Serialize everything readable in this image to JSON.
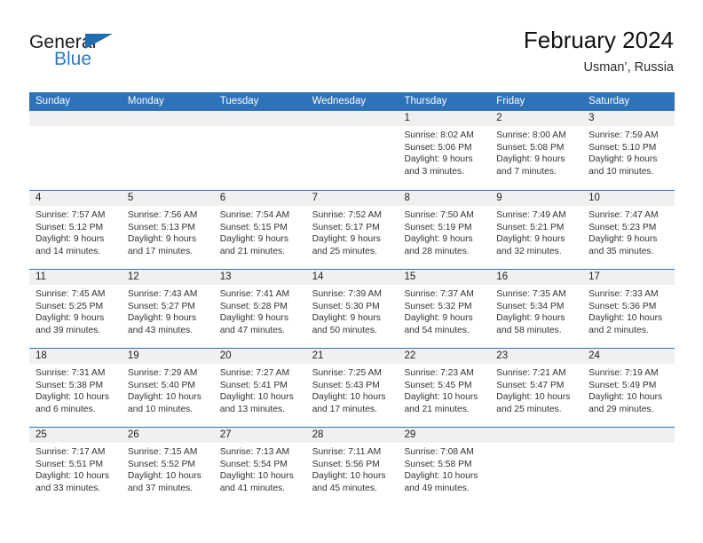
{
  "brand": {
    "name_top": "General",
    "name_bottom": "Blue",
    "accent_color": "#2E7BC4",
    "flag_icon": "triangle-flag-icon"
  },
  "header": {
    "title": "February 2024",
    "subtitle": "Usman’, Russia"
  },
  "theme": {
    "header_blue": "#2E72B8",
    "daynum_band": "#F0F0F0",
    "text": "#333333"
  },
  "weekdays": [
    "Sunday",
    "Monday",
    "Tuesday",
    "Wednesday",
    "Thursday",
    "Friday",
    "Saturday"
  ],
  "weeks": [
    [
      {
        "day": "",
        "sunrise": "",
        "sunset": "",
        "daylight1": "",
        "daylight2": ""
      },
      {
        "day": "",
        "sunrise": "",
        "sunset": "",
        "daylight1": "",
        "daylight2": ""
      },
      {
        "day": "",
        "sunrise": "",
        "sunset": "",
        "daylight1": "",
        "daylight2": ""
      },
      {
        "day": "",
        "sunrise": "",
        "sunset": "",
        "daylight1": "",
        "daylight2": ""
      },
      {
        "day": "1",
        "sunrise": "Sunrise: 8:02 AM",
        "sunset": "Sunset: 5:06 PM",
        "daylight1": "Daylight: 9 hours",
        "daylight2": "and 3 minutes."
      },
      {
        "day": "2",
        "sunrise": "Sunrise: 8:00 AM",
        "sunset": "Sunset: 5:08 PM",
        "daylight1": "Daylight: 9 hours",
        "daylight2": "and 7 minutes."
      },
      {
        "day": "3",
        "sunrise": "Sunrise: 7:59 AM",
        "sunset": "Sunset: 5:10 PM",
        "daylight1": "Daylight: 9 hours",
        "daylight2": "and 10 minutes."
      }
    ],
    [
      {
        "day": "4",
        "sunrise": "Sunrise: 7:57 AM",
        "sunset": "Sunset: 5:12 PM",
        "daylight1": "Daylight: 9 hours",
        "daylight2": "and 14 minutes."
      },
      {
        "day": "5",
        "sunrise": "Sunrise: 7:56 AM",
        "sunset": "Sunset: 5:13 PM",
        "daylight1": "Daylight: 9 hours",
        "daylight2": "and 17 minutes."
      },
      {
        "day": "6",
        "sunrise": "Sunrise: 7:54 AM",
        "sunset": "Sunset: 5:15 PM",
        "daylight1": "Daylight: 9 hours",
        "daylight2": "and 21 minutes."
      },
      {
        "day": "7",
        "sunrise": "Sunrise: 7:52 AM",
        "sunset": "Sunset: 5:17 PM",
        "daylight1": "Daylight: 9 hours",
        "daylight2": "and 25 minutes."
      },
      {
        "day": "8",
        "sunrise": "Sunrise: 7:50 AM",
        "sunset": "Sunset: 5:19 PM",
        "daylight1": "Daylight: 9 hours",
        "daylight2": "and 28 minutes."
      },
      {
        "day": "9",
        "sunrise": "Sunrise: 7:49 AM",
        "sunset": "Sunset: 5:21 PM",
        "daylight1": "Daylight: 9 hours",
        "daylight2": "and 32 minutes."
      },
      {
        "day": "10",
        "sunrise": "Sunrise: 7:47 AM",
        "sunset": "Sunset: 5:23 PM",
        "daylight1": "Daylight: 9 hours",
        "daylight2": "and 35 minutes."
      }
    ],
    [
      {
        "day": "11",
        "sunrise": "Sunrise: 7:45 AM",
        "sunset": "Sunset: 5:25 PM",
        "daylight1": "Daylight: 9 hours",
        "daylight2": "and 39 minutes."
      },
      {
        "day": "12",
        "sunrise": "Sunrise: 7:43 AM",
        "sunset": "Sunset: 5:27 PM",
        "daylight1": "Daylight: 9 hours",
        "daylight2": "and 43 minutes."
      },
      {
        "day": "13",
        "sunrise": "Sunrise: 7:41 AM",
        "sunset": "Sunset: 5:28 PM",
        "daylight1": "Daylight: 9 hours",
        "daylight2": "and 47 minutes."
      },
      {
        "day": "14",
        "sunrise": "Sunrise: 7:39 AM",
        "sunset": "Sunset: 5:30 PM",
        "daylight1": "Daylight: 9 hours",
        "daylight2": "and 50 minutes."
      },
      {
        "day": "15",
        "sunrise": "Sunrise: 7:37 AM",
        "sunset": "Sunset: 5:32 PM",
        "daylight1": "Daylight: 9 hours",
        "daylight2": "and 54 minutes."
      },
      {
        "day": "16",
        "sunrise": "Sunrise: 7:35 AM",
        "sunset": "Sunset: 5:34 PM",
        "daylight1": "Daylight: 9 hours",
        "daylight2": "and 58 minutes."
      },
      {
        "day": "17",
        "sunrise": "Sunrise: 7:33 AM",
        "sunset": "Sunset: 5:36 PM",
        "daylight1": "Daylight: 10 hours",
        "daylight2": "and 2 minutes."
      }
    ],
    [
      {
        "day": "18",
        "sunrise": "Sunrise: 7:31 AM",
        "sunset": "Sunset: 5:38 PM",
        "daylight1": "Daylight: 10 hours",
        "daylight2": "and 6 minutes."
      },
      {
        "day": "19",
        "sunrise": "Sunrise: 7:29 AM",
        "sunset": "Sunset: 5:40 PM",
        "daylight1": "Daylight: 10 hours",
        "daylight2": "and 10 minutes."
      },
      {
        "day": "20",
        "sunrise": "Sunrise: 7:27 AM",
        "sunset": "Sunset: 5:41 PM",
        "daylight1": "Daylight: 10 hours",
        "daylight2": "and 13 minutes."
      },
      {
        "day": "21",
        "sunrise": "Sunrise: 7:25 AM",
        "sunset": "Sunset: 5:43 PM",
        "daylight1": "Daylight: 10 hours",
        "daylight2": "and 17 minutes."
      },
      {
        "day": "22",
        "sunrise": "Sunrise: 7:23 AM",
        "sunset": "Sunset: 5:45 PM",
        "daylight1": "Daylight: 10 hours",
        "daylight2": "and 21 minutes."
      },
      {
        "day": "23",
        "sunrise": "Sunrise: 7:21 AM",
        "sunset": "Sunset: 5:47 PM",
        "daylight1": "Daylight: 10 hours",
        "daylight2": "and 25 minutes."
      },
      {
        "day": "24",
        "sunrise": "Sunrise: 7:19 AM",
        "sunset": "Sunset: 5:49 PM",
        "daylight1": "Daylight: 10 hours",
        "daylight2": "and 29 minutes."
      }
    ],
    [
      {
        "day": "25",
        "sunrise": "Sunrise: 7:17 AM",
        "sunset": "Sunset: 5:51 PM",
        "daylight1": "Daylight: 10 hours",
        "daylight2": "and 33 minutes."
      },
      {
        "day": "26",
        "sunrise": "Sunrise: 7:15 AM",
        "sunset": "Sunset: 5:52 PM",
        "daylight1": "Daylight: 10 hours",
        "daylight2": "and 37 minutes."
      },
      {
        "day": "27",
        "sunrise": "Sunrise: 7:13 AM",
        "sunset": "Sunset: 5:54 PM",
        "daylight1": "Daylight: 10 hours",
        "daylight2": "and 41 minutes."
      },
      {
        "day": "28",
        "sunrise": "Sunrise: 7:11 AM",
        "sunset": "Sunset: 5:56 PM",
        "daylight1": "Daylight: 10 hours",
        "daylight2": "and 45 minutes."
      },
      {
        "day": "29",
        "sunrise": "Sunrise: 7:08 AM",
        "sunset": "Sunset: 5:58 PM",
        "daylight1": "Daylight: 10 hours",
        "daylight2": "and 49 minutes."
      },
      {
        "day": "",
        "sunrise": "",
        "sunset": "",
        "daylight1": "",
        "daylight2": ""
      },
      {
        "day": "",
        "sunrise": "",
        "sunset": "",
        "daylight1": "",
        "daylight2": ""
      }
    ]
  ]
}
